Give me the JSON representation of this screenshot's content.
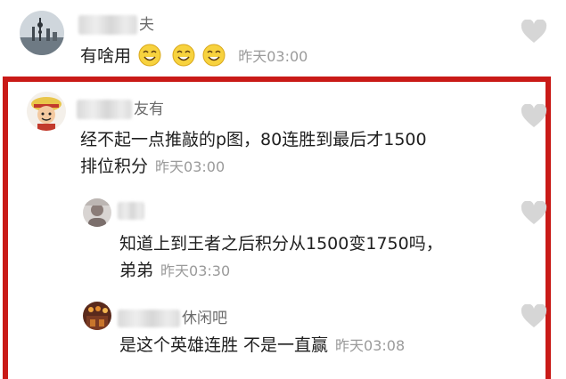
{
  "comments": [
    {
      "name_visible": "夫",
      "text": "有啥用",
      "time": "昨天03:00",
      "emoji_count": 3,
      "avatar_icon": "city-skyline-avatar-icon"
    },
    {
      "name_visible": "友有",
      "text_line1": "经不起一点推敲的p图，80连胜到最后才1500",
      "text_line2": "排位积分",
      "time": "昨天03:00",
      "avatar_icon": "anime-character-avatar-icon"
    },
    {
      "name_visible": "",
      "text_line1": "知道上到王者之后积分从1500变1750吗，",
      "text_line2": "弟弟",
      "time": "昨天03:30",
      "avatar_icon": "person-avatar-icon"
    },
    {
      "name_visible": "休闲吧",
      "text": "是这个英雄连胜 不是一直赢",
      "time": "昨天03:08",
      "avatar_icon": "shop-avatar-icon"
    }
  ],
  "colors": {
    "highlight_frame": "#c91a17",
    "like_icon": "#d6d6d6",
    "time_text": "#9a9a9a",
    "body_text": "#1f1f1f"
  }
}
